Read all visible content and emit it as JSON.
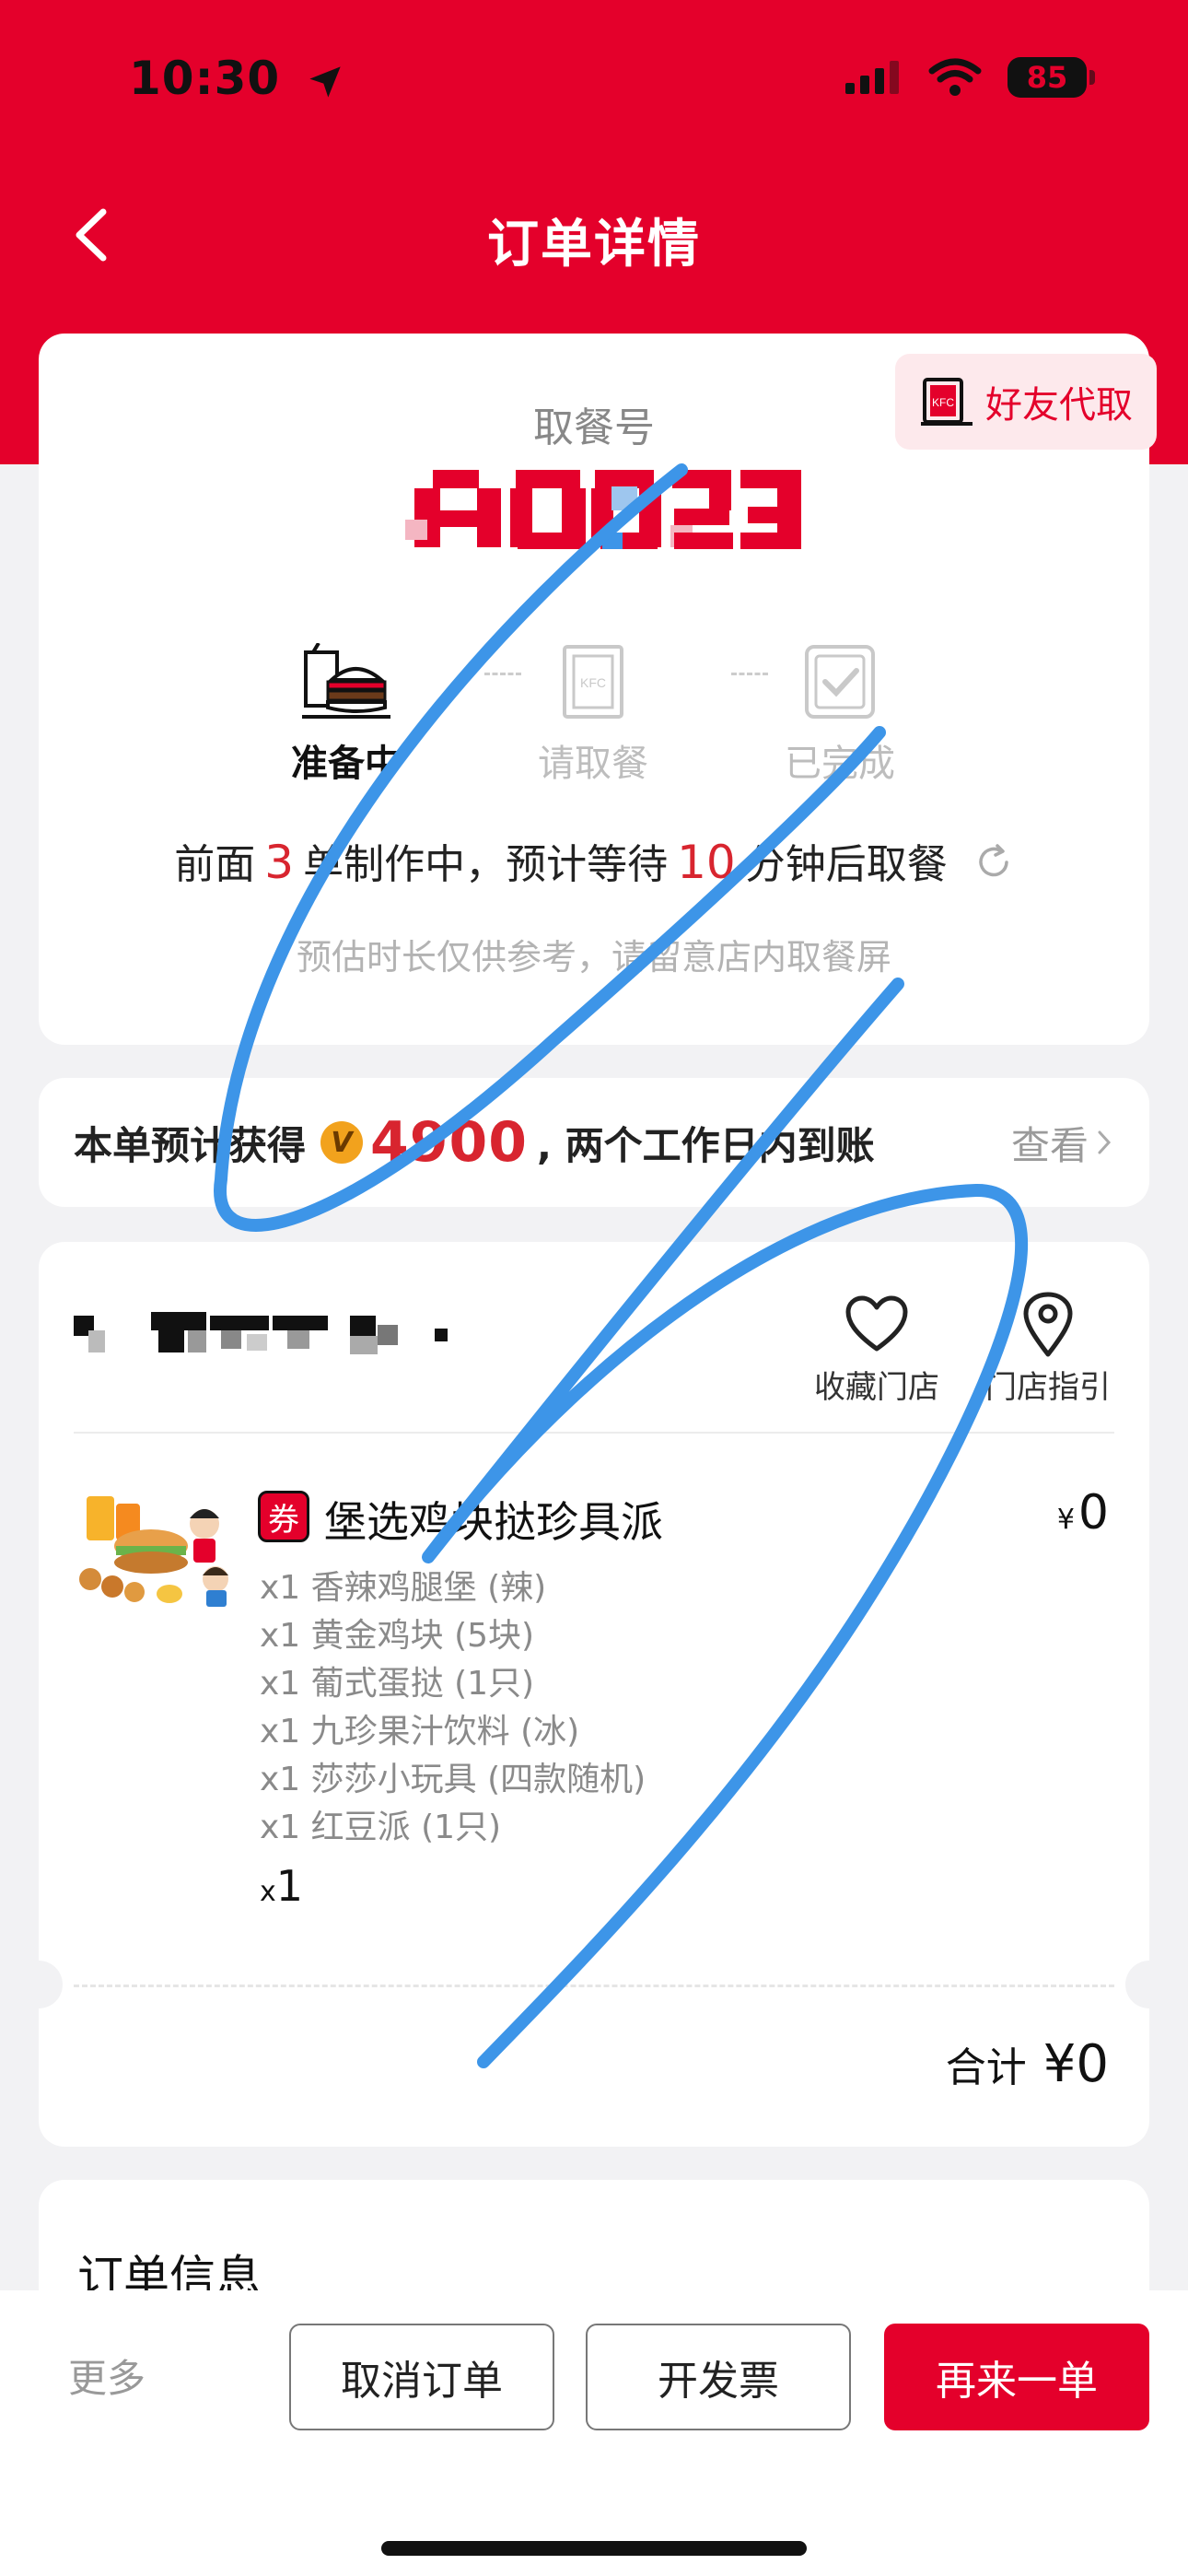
{
  "status_bar": {
    "time": "10:30",
    "battery": "85"
  },
  "nav": {
    "title": "订单详情"
  },
  "pickup": {
    "friend_button": "好友代取",
    "label": "取餐号",
    "number": "A0023",
    "steps": [
      {
        "label": "准备中",
        "active": true
      },
      {
        "label": "请取餐",
        "active": false
      },
      {
        "label": "已完成",
        "active": false
      }
    ],
    "wait": {
      "prefix": "前面",
      "orders_ahead": "3",
      "mid": "单制作中，预计等待",
      "minutes": "10",
      "suffix": "分钟后取餐"
    },
    "hint": "预估时长仅供参考，请留意店内取餐屏"
  },
  "points": {
    "prefix": "本单预计获得",
    "amount": "4900",
    "suffix": ", 两个工作日内到账",
    "view": "查看"
  },
  "store": {
    "actions": [
      {
        "label": "收藏门店"
      },
      {
        "label": "门店指引"
      }
    ]
  },
  "item": {
    "tag": "券",
    "name": "堡选鸡块挞珍具派",
    "currency": "¥",
    "price": "0",
    "components": [
      "x1 香辣鸡腿堡 (辣)",
      "x1 黄金鸡块 (5块)",
      "x1 葡式蛋挞 (1只)",
      "x1 九珍果汁饮料 (冰)",
      "x1 莎莎小玩具 (四款随机)",
      "x1 红豆派 (1只)"
    ],
    "qty_prefix": "x",
    "qty": "1"
  },
  "total": {
    "label": "合计",
    "amount": "¥0"
  },
  "order_info": {
    "title": "订单信息"
  },
  "bottom": {
    "more": "更多",
    "cancel": "取消订单",
    "invoice": "开发票",
    "reorder": "再来一单"
  },
  "colors": {
    "brand_red": "#e4002b",
    "highlight_red": "#d8252f",
    "scribble_blue": "#3d95e8"
  }
}
